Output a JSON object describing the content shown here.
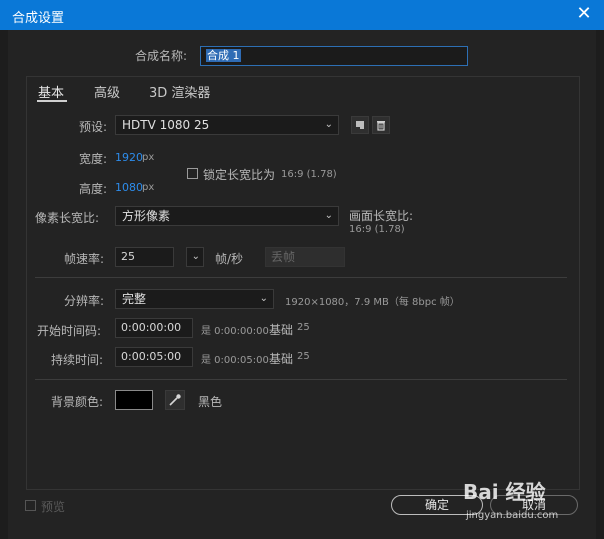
{
  "window": {
    "title": "合成设置"
  },
  "name_field": {
    "label": "合成名称:",
    "value": "合成 1"
  },
  "tabs": [
    {
      "label": "基本",
      "active": true
    },
    {
      "label": "高级",
      "active": false
    },
    {
      "label": "3D 渲染器",
      "active": false
    }
  ],
  "preset": {
    "label": "预设:",
    "value": "HDTV 1080 25"
  },
  "width": {
    "label": "宽度:",
    "value": "1920",
    "unit": "px"
  },
  "height": {
    "label": "高度:",
    "value": "1080",
    "unit": "px"
  },
  "lock_aspect": {
    "label": "锁定长宽比为",
    "ratio": "16:9 (1.78)",
    "checked": false
  },
  "pixel_aspect": {
    "label": "像素长宽比:",
    "value": "方形像素"
  },
  "frame_aspect": {
    "label": "画面长宽比:",
    "value": "16:9 (1.78)"
  },
  "frame_rate": {
    "label": "帧速率:",
    "value": "25",
    "unit": "帧/秒",
    "drop_frame": "丢帧"
  },
  "resolution": {
    "label": "分辨率:",
    "value": "完整",
    "info": "1920×1080，7.9 MB（每 8bpc 帧）"
  },
  "start_timecode": {
    "label": "开始时间码:",
    "value": "0:00:00:00",
    "is": "是 0:00:00:00",
    "base_label": "基础",
    "base": "25"
  },
  "duration": {
    "label": "持续时间:",
    "value": "0:00:05:00",
    "is": "是 0:00:05:00",
    "base_label": "基础",
    "base": "25"
  },
  "background": {
    "label": "背景颜色:",
    "color_name": "黑色",
    "color": "#000000"
  },
  "footer": {
    "preview": "预览",
    "ok": "确定",
    "cancel": "取消"
  },
  "colors": {
    "titlebar": "#0a78d7",
    "accent_value": "#2d8ceb"
  },
  "watermark": {
    "brand": "Bai 经验",
    "url": "jingyan.baidu.com"
  }
}
